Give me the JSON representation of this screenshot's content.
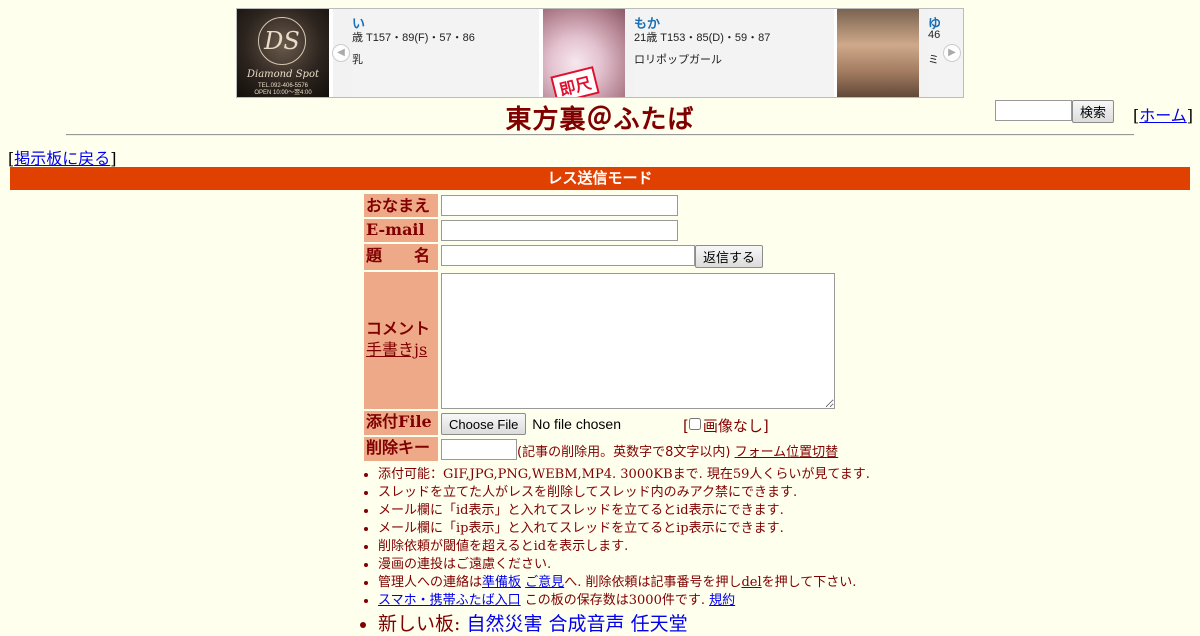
{
  "ad": {
    "logo": {
      "monogram": "DS",
      "script": "Diamond Spot",
      "tel": "TEL.092-406-5576",
      "open": "OPEN 10:00〜翌4:00"
    },
    "cards": [
      {
        "name": "い",
        "spec": "歳 T157・89(F)・57・86",
        "desc": "乳"
      },
      {
        "name": "もか",
        "spec": "21歳 T153・85(D)・59・87",
        "desc": "ロリポップガール"
      },
      {
        "name": "ゆ",
        "spec": "46",
        "desc": "ミ"
      }
    ],
    "badge": "即尺",
    "prev_icon": "chevron-left-icon",
    "next_icon": "chevron-right-icon"
  },
  "header": {
    "title": "東方裏＠ふたば",
    "search_button": "検索",
    "home_link": "ホーム"
  },
  "nav": {
    "back_link": "掲示板に戻る"
  },
  "mode_bar": "レス送信モード",
  "form": {
    "name_label": "おなまえ",
    "email_label": "E-mail",
    "subject_label": "題　　名",
    "submit_button": "返信する",
    "comment_label": "コメント",
    "tegaki_link": "手書きjs",
    "file_label": "添付File",
    "file_button": "Choose File",
    "file_status": "No file chosen",
    "noimage_label": "画像なし",
    "delkey_label": "削除キー",
    "delkey_note": "(記事の削除用。英数字で8文字以内)",
    "form_toggle_link": "フォーム位置切替"
  },
  "notes": {
    "n1": "添付可能：GIF,JPG,PNG,WEBM,MP4. 3000KBまで. 現在59人くらいが見てます.",
    "n2": "スレッドを立てた人がレスを削除してスレッド内のみアク禁にできます.",
    "n3": "メール欄に「id表示」と入れてスレッドを立てるとid表示にできます.",
    "n4": "メール欄に「ip表示」と入れてスレッドを立てるとip表示にできます.",
    "n5": "削除依頼が閾値を超えるとidを表示します.",
    "n6": "漫画の連投はご遠慮ください.",
    "n7_pre": "管理人への連絡は",
    "n7_link1": "準備板",
    "n7_link2": "ご意見",
    "n7_mid": "へ. 削除依頼は記事番号を押し",
    "n7_link3": "del",
    "n7_post": "を押して下さい.",
    "n8_link1": "スマホ・携帯ふたば入口",
    "n8_mid": "この板の保存数は3000件です.",
    "n8_link2": "規約",
    "n9_pre": "新しい板:",
    "n9_link1": "自然災害",
    "n9_link2": "合成音声",
    "n9_link3": "任天堂"
  },
  "colors": {
    "background": "#ffffee",
    "text": "#800000",
    "mode_bar": "#e04000",
    "label_bg": "#eeaa88",
    "link": "#0000ee"
  }
}
